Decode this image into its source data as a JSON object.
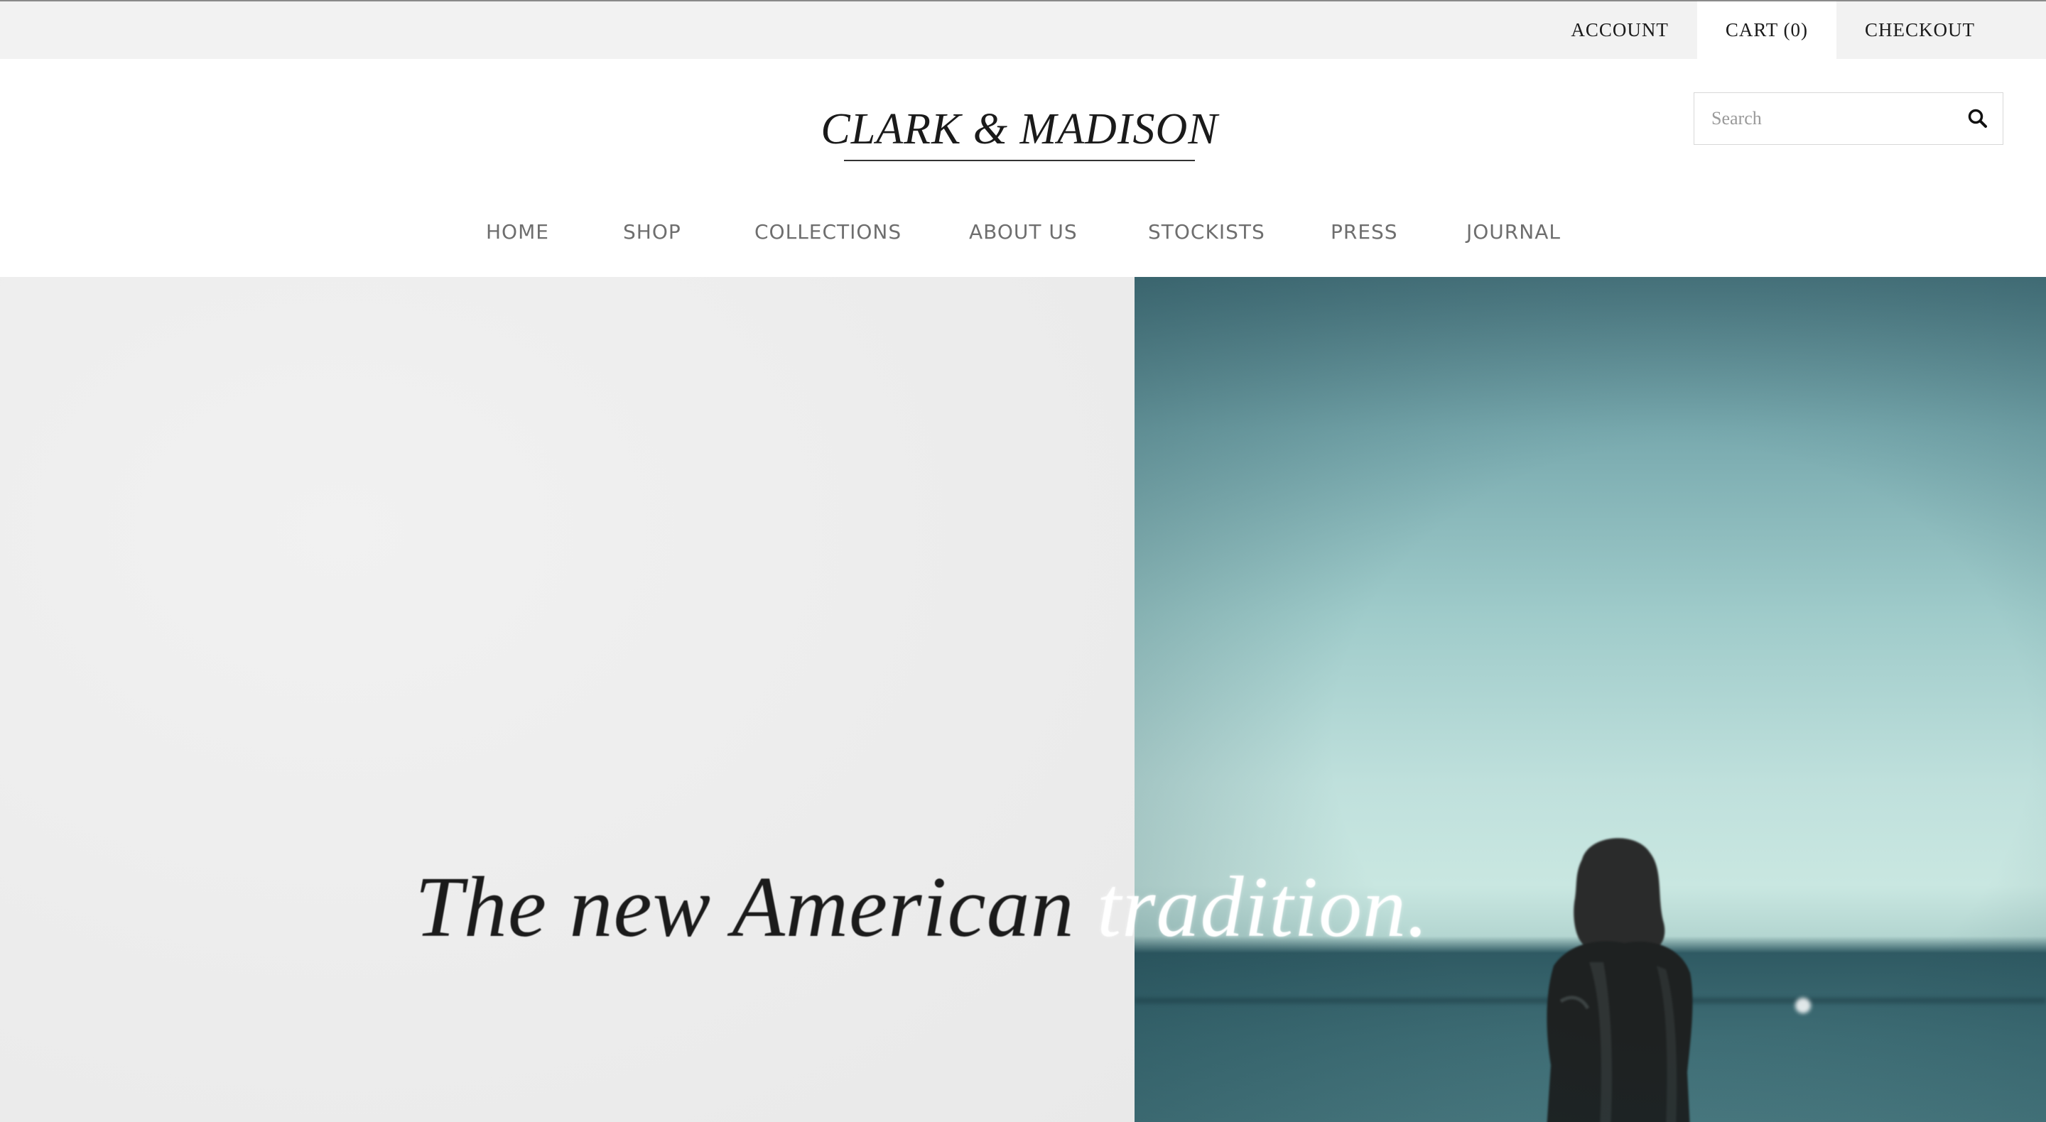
{
  "topbar": {
    "links": [
      {
        "label": "ACCOUNT"
      },
      {
        "label": "CART (0)"
      },
      {
        "label": "CHECKOUT"
      }
    ]
  },
  "header": {
    "logo": "CLARK & MADISON",
    "search": {
      "placeholder": "Search",
      "icon": "search-icon"
    }
  },
  "nav": {
    "items": [
      {
        "label": "HOME"
      },
      {
        "label": "SHOP"
      },
      {
        "label": "COLLECTIONS"
      },
      {
        "label": "ABOUT US"
      },
      {
        "label": "STOCKISTS"
      },
      {
        "label": "PRESS"
      },
      {
        "label": "JOURNAL"
      }
    ]
  },
  "hero": {
    "tagline_dark": "The new American",
    "tagline_light": "tradition."
  },
  "colors": {
    "topbar_bg": "#f2f2f2",
    "nav_text": "#6e6e6e",
    "text_dark": "#1a1a1a",
    "sea": "#9fcbca"
  }
}
